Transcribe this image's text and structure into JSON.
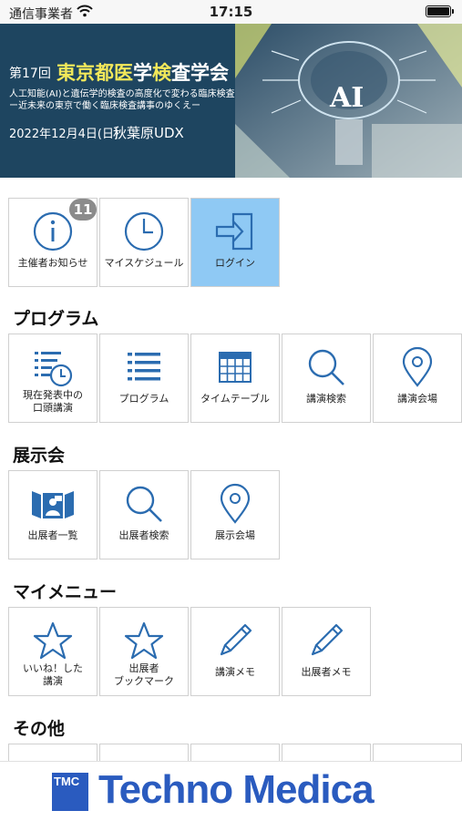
{
  "status_bar": {
    "carrier": "通信事業者",
    "time": "17:15"
  },
  "banner": {
    "edition": "第17回",
    "conf_a": "東京都",
    "conf_b": "医",
    "conf_c": "学",
    "conf_d": "検",
    "conf_e": "査学会",
    "subtitle_1": "人工知能(AI)と遺伝学的検査の高度化で変わる臨床検査",
    "subtitle_2": "ー近未来の東京で働く臨床検査講事のゆくえー",
    "date": "2022年12月4日(日)",
    "venue": "秋葉原UDX",
    "ai_text": "AI",
    "highlight_color": "#f2e85a"
  },
  "top_menu": {
    "items": [
      {
        "label": "主催者お知らせ",
        "icon": "info-icon",
        "badge": "11"
      },
      {
        "label": "マイスケジュール",
        "icon": "clock-icon"
      },
      {
        "label": "ログイン",
        "icon": "login-icon",
        "active": true
      }
    ]
  },
  "sections": {
    "program": {
      "title": "プログラム",
      "items": [
        {
          "label_1": "現在発表中の",
          "label_2": "口頭講演",
          "icon": "list-clock-icon"
        },
        {
          "label": "プログラム",
          "icon": "list-icon"
        },
        {
          "label": "タイムテーブル",
          "icon": "calendar-icon"
        },
        {
          "label": "講演検索",
          "icon": "search-icon"
        },
        {
          "label": "講演会場",
          "icon": "location-pin-icon"
        }
      ]
    },
    "exhibition": {
      "title": "展示会",
      "items": [
        {
          "label": "出展者一覧",
          "icon": "exhibitor-booth-icon"
        },
        {
          "label": "出展者検索",
          "icon": "search-icon"
        },
        {
          "label": "展示会場",
          "icon": "location-pin-icon"
        }
      ]
    },
    "my_menu": {
      "title": "マイメニュー",
      "items": [
        {
          "label_1": "いいね！した",
          "label_2": "講演",
          "icon": "star-icon"
        },
        {
          "label_1": "出展者",
          "label_2": "ブックマーク",
          "icon": "star-icon"
        },
        {
          "label": "講演メモ",
          "icon": "pencil-icon"
        },
        {
          "label": "出展者メモ",
          "icon": "pencil-icon"
        }
      ]
    },
    "other": {
      "title": "その他"
    }
  },
  "footer": {
    "logo_small": "TMC",
    "brand": "Techno Medica"
  },
  "colors": {
    "icon_blue": "#2b6cb0",
    "active_tile": "#8fc9f4",
    "banner_bg": "#1e4560",
    "brand_blue": "#2a5bbf"
  }
}
